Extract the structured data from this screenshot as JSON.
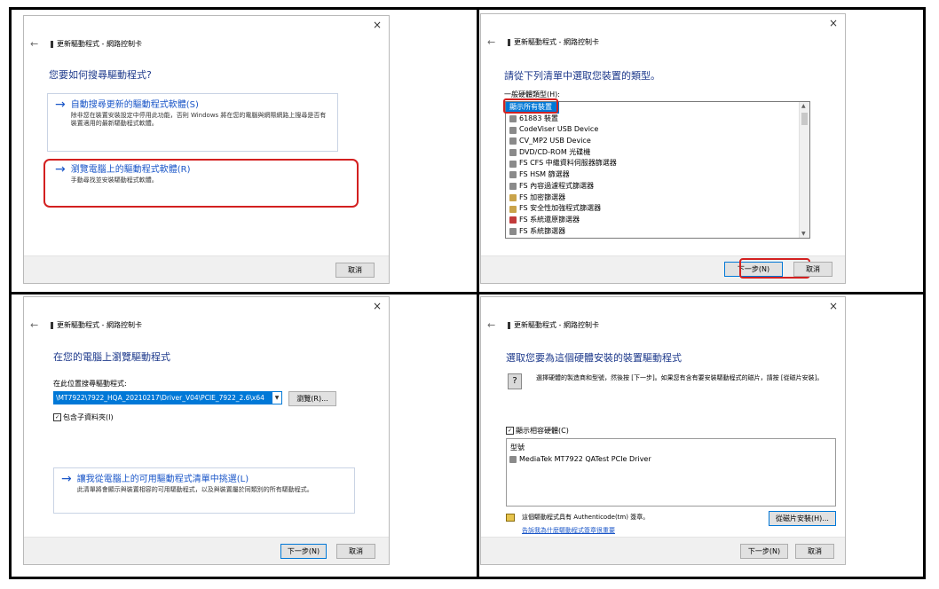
{
  "common": {
    "close_glyph": "×",
    "back_glyph": "←",
    "header": "更新驅動程式 - 網路控制卡",
    "cancel": "取消",
    "next": "下一步(N)"
  },
  "panel1": {
    "title": "您要如何搜尋驅動程式?",
    "option_auto": {
      "title": "自動搜尋更新的驅動程式軟體(S)",
      "desc": "除非您在裝置安裝設定中停用此功能，否則 Windows 將在您的電腦與網際網路上搜尋是否有裝置適用的最新驅動程式軟體。"
    },
    "option_browse": {
      "title": "瀏覽電腦上的驅動程式軟體(R)",
      "desc": "手動尋找並安裝驅動程式軟體。"
    }
  },
  "panel2": {
    "title": "請從下列清單中選取您裝置的類型。",
    "list_label": "一般硬體類型(H):",
    "items": [
      "顯示所有裝置",
      "61883 裝置",
      "CodeViser USB Device",
      "CV_MP2 USB Device",
      "DVD/CD-ROM 光碟機",
      "FS CFS 中繼資料伺服器篩選器",
      "FS HSM 篩選器",
      "FS 內容過濾程式篩選器",
      "FS 加密篩選器",
      "FS 安全性加強程式篩選器",
      "FS 系統還原篩選器",
      "FS 系統篩選器"
    ]
  },
  "panel3": {
    "title": "在您的電腦上瀏覽驅動程式",
    "path_label": "在此位置搜尋驅動程式:",
    "path_value": "\\MT7922\\7922_HQA_20210217\\Driver_V04\\PCIE_7922_2.6\\x64",
    "browse": "瀏覽(R)...",
    "include_sub": "包含子資料夾(I)",
    "pick": {
      "title": "讓我從電腦上的可用驅動程式清單中挑選(L)",
      "desc": "此清單將會顯示與裝置相容的可用驅動程式，以及與裝置屬於同類別的所有驅動程式。"
    }
  },
  "panel4": {
    "title": "選取您要為這個硬體安裝的裝置驅動程式",
    "info": "選擇硬體的製造商和型號，然後按 [下一步]。如果您有含有要安裝驅動程式的磁片，請按 [從磁片安裝]。",
    "compat": "顯示相容硬體(C)",
    "col_model": "型號",
    "model_item": "MediaTek MT7922 QATest PCIe Driver",
    "signed": "這個驅動程式具有 Authenticode(tm) 簽章。",
    "link": "告訴我為什麼驅動程式簽章很重要",
    "have_disk": "從磁片安裝(H)..."
  }
}
